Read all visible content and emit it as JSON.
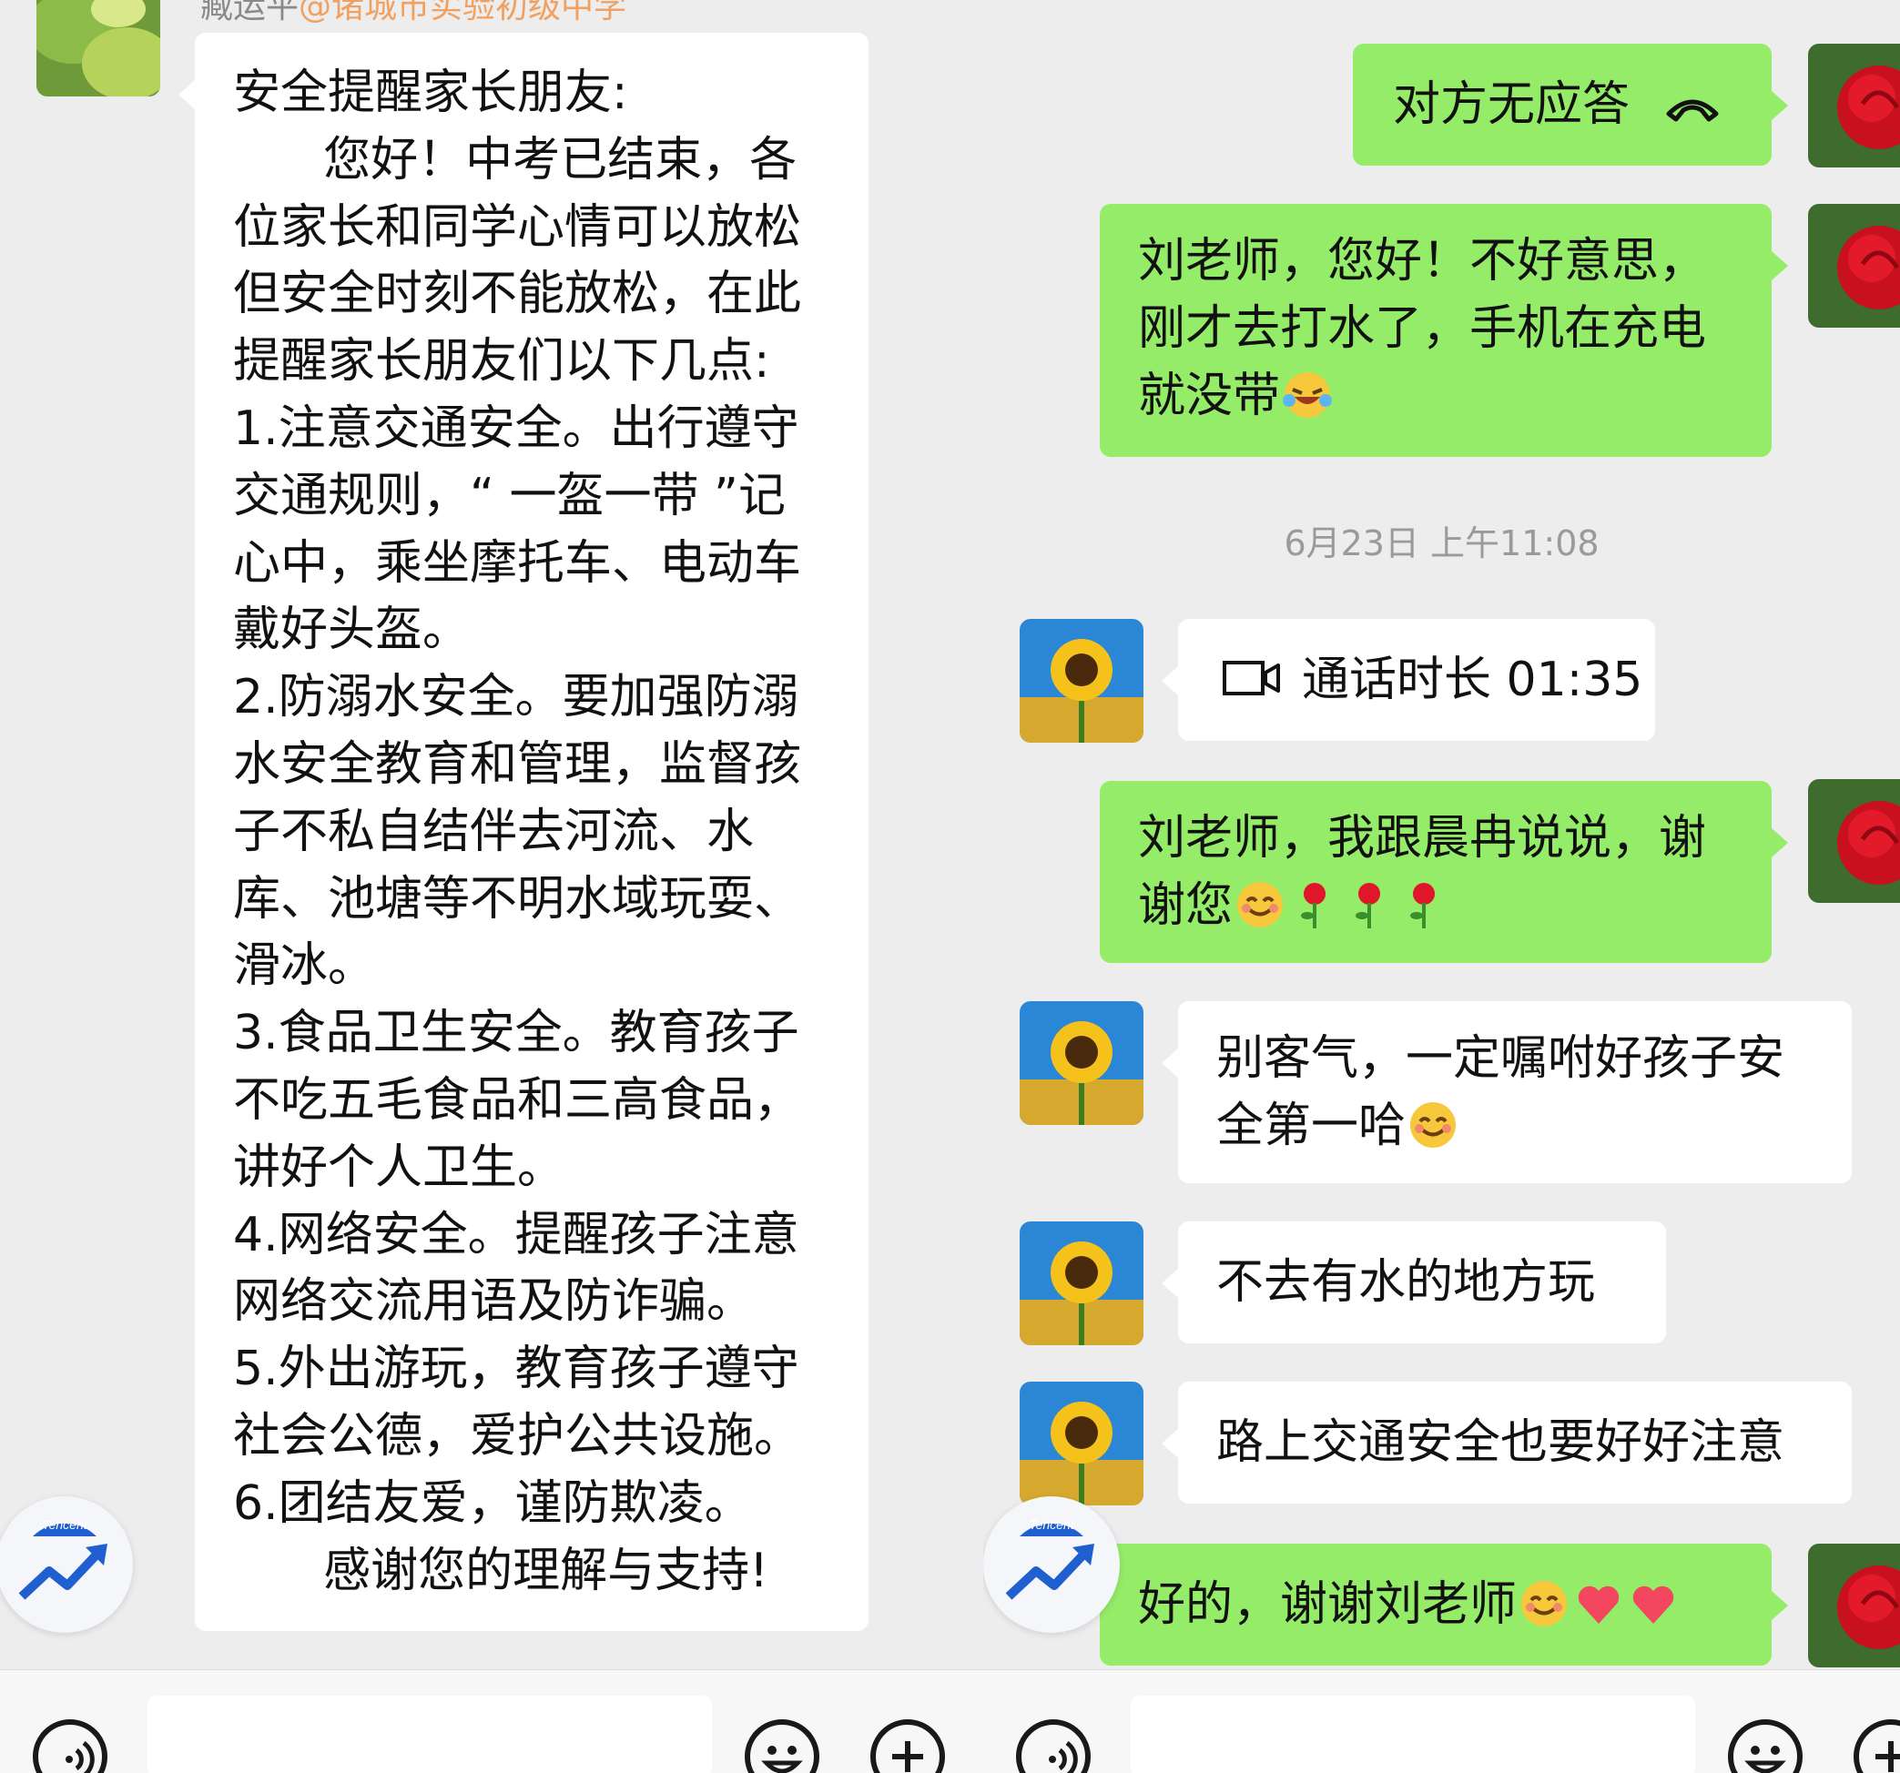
{
  "left": {
    "sender_name": "臧运平",
    "sender_group": "@诸城市实验初级中学",
    "message_lines": [
      "安全提醒家长朋友:",
      "      您好！中考已结束，各",
      "位家长和同学心情可以放松",
      "但安全时刻不能放松，在此",
      "提醒家长朋友们以下几点:",
      "1.注意交通安全。出行遵守",
      "交通规则，“ 一盔一带 ”记",
      "心中，乘坐摩托车、电动车",
      "戴好头盔。",
      "2.防溺水安全。要加强防溺",
      "水安全教育和管理，监督孩",
      "子不私自结伴去河流、水",
      "库、池塘等不明水域玩耍、",
      "滑冰。",
      "3.食品卫生安全。教育孩子",
      "不吃五毛食品和三高食品，",
      "讲好个人卫生。",
      "4.网络安全。提醒孩子注意",
      "网络交流用语及防诈骗。",
      "5.外出游玩，教育孩子遵守",
      "社会公德，爱护公共设施。",
      "6.团结友爱，谨防欺凌。",
      "      感谢您的理解与支持!"
    ],
    "badge_label": "Tencent"
  },
  "right": {
    "msg_no_answer": "对方无应答",
    "msg_reply1_lines": [
      "刘老师，您好！不好意思，",
      "刚才去打水了，手机在充电",
      "就没带"
    ],
    "timestamp": "6月23日 上午11:08",
    "call_duration": "通话时长 01:35",
    "msg_reply2_lines": [
      "刘老师，我跟晨冉说说，谢",
      "谢您"
    ],
    "teacher_msg1_lines": [
      "别客气，一定嘱咐好孩子安",
      "全第一哈"
    ],
    "teacher_msg2": "不去有水的地方玩",
    "teacher_msg3": "路上交通安全也要好好注意",
    "msg_reply3": "好的，谢谢刘老师",
    "badge_label": "Tencent"
  },
  "icons": {
    "voice": "voice-icon",
    "emoji": "emoji-icon",
    "plus": "plus-icon",
    "video_call": "video-call-icon",
    "hangup": "phone-hangup-icon"
  },
  "colors": {
    "self_bubble": "#95ec69",
    "other_bubble": "#ffffff",
    "background": "#ededed",
    "mention": "#f0a162"
  }
}
